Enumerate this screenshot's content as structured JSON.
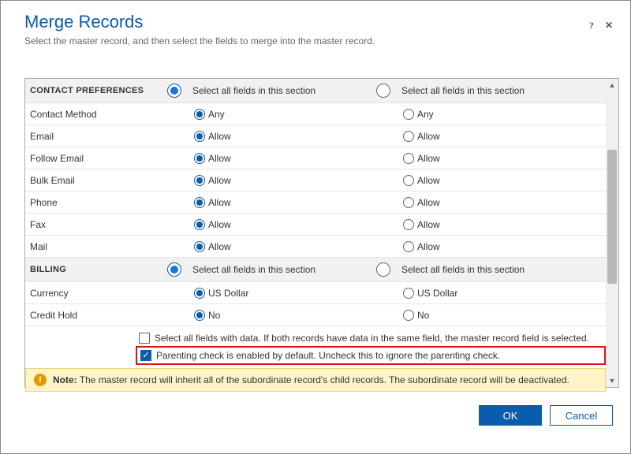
{
  "header": {
    "title": "Merge Records",
    "subtitle": "Select the master record, and then select the fields to merge into the master record."
  },
  "sections": {
    "contact_prefs": {
      "label": "CONTACT PREFERENCES",
      "select_all_a": "Select all fields in this section",
      "select_all_b": "Select all fields in this section"
    },
    "billing": {
      "label": "BILLING",
      "select_all_a": "Select all fields in this section",
      "select_all_b": "Select all fields in this section"
    }
  },
  "fields": {
    "contact_method": {
      "label": "Contact Method",
      "a": "Any",
      "b": "Any"
    },
    "email": {
      "label": "Email",
      "a": "Allow",
      "b": "Allow"
    },
    "follow_email": {
      "label": "Follow Email",
      "a": "Allow",
      "b": "Allow"
    },
    "bulk_email": {
      "label": "Bulk Email",
      "a": "Allow",
      "b": "Allow"
    },
    "phone": {
      "label": "Phone",
      "a": "Allow",
      "b": "Allow"
    },
    "fax": {
      "label": "Fax",
      "a": "Allow",
      "b": "Allow"
    },
    "mail": {
      "label": "Mail",
      "a": "Allow",
      "b": "Allow"
    },
    "currency": {
      "label": "Currency",
      "a": "US Dollar",
      "b": "US Dollar"
    },
    "credit_hold": {
      "label": "Credit Hold",
      "a": "No",
      "b": "No"
    }
  },
  "options": {
    "select_all_data": "Select all fields with data. If both records have data in the same field, the master record field is selected.",
    "parenting_check": "Parenting check is enabled by default. Uncheck this to ignore the parenting check."
  },
  "note": {
    "prefix": "Note:",
    "text": "The master record will inherit all of the subordinate record's child records. The subordinate record will be deactivated."
  },
  "footer": {
    "ok": "OK",
    "cancel": "Cancel"
  }
}
